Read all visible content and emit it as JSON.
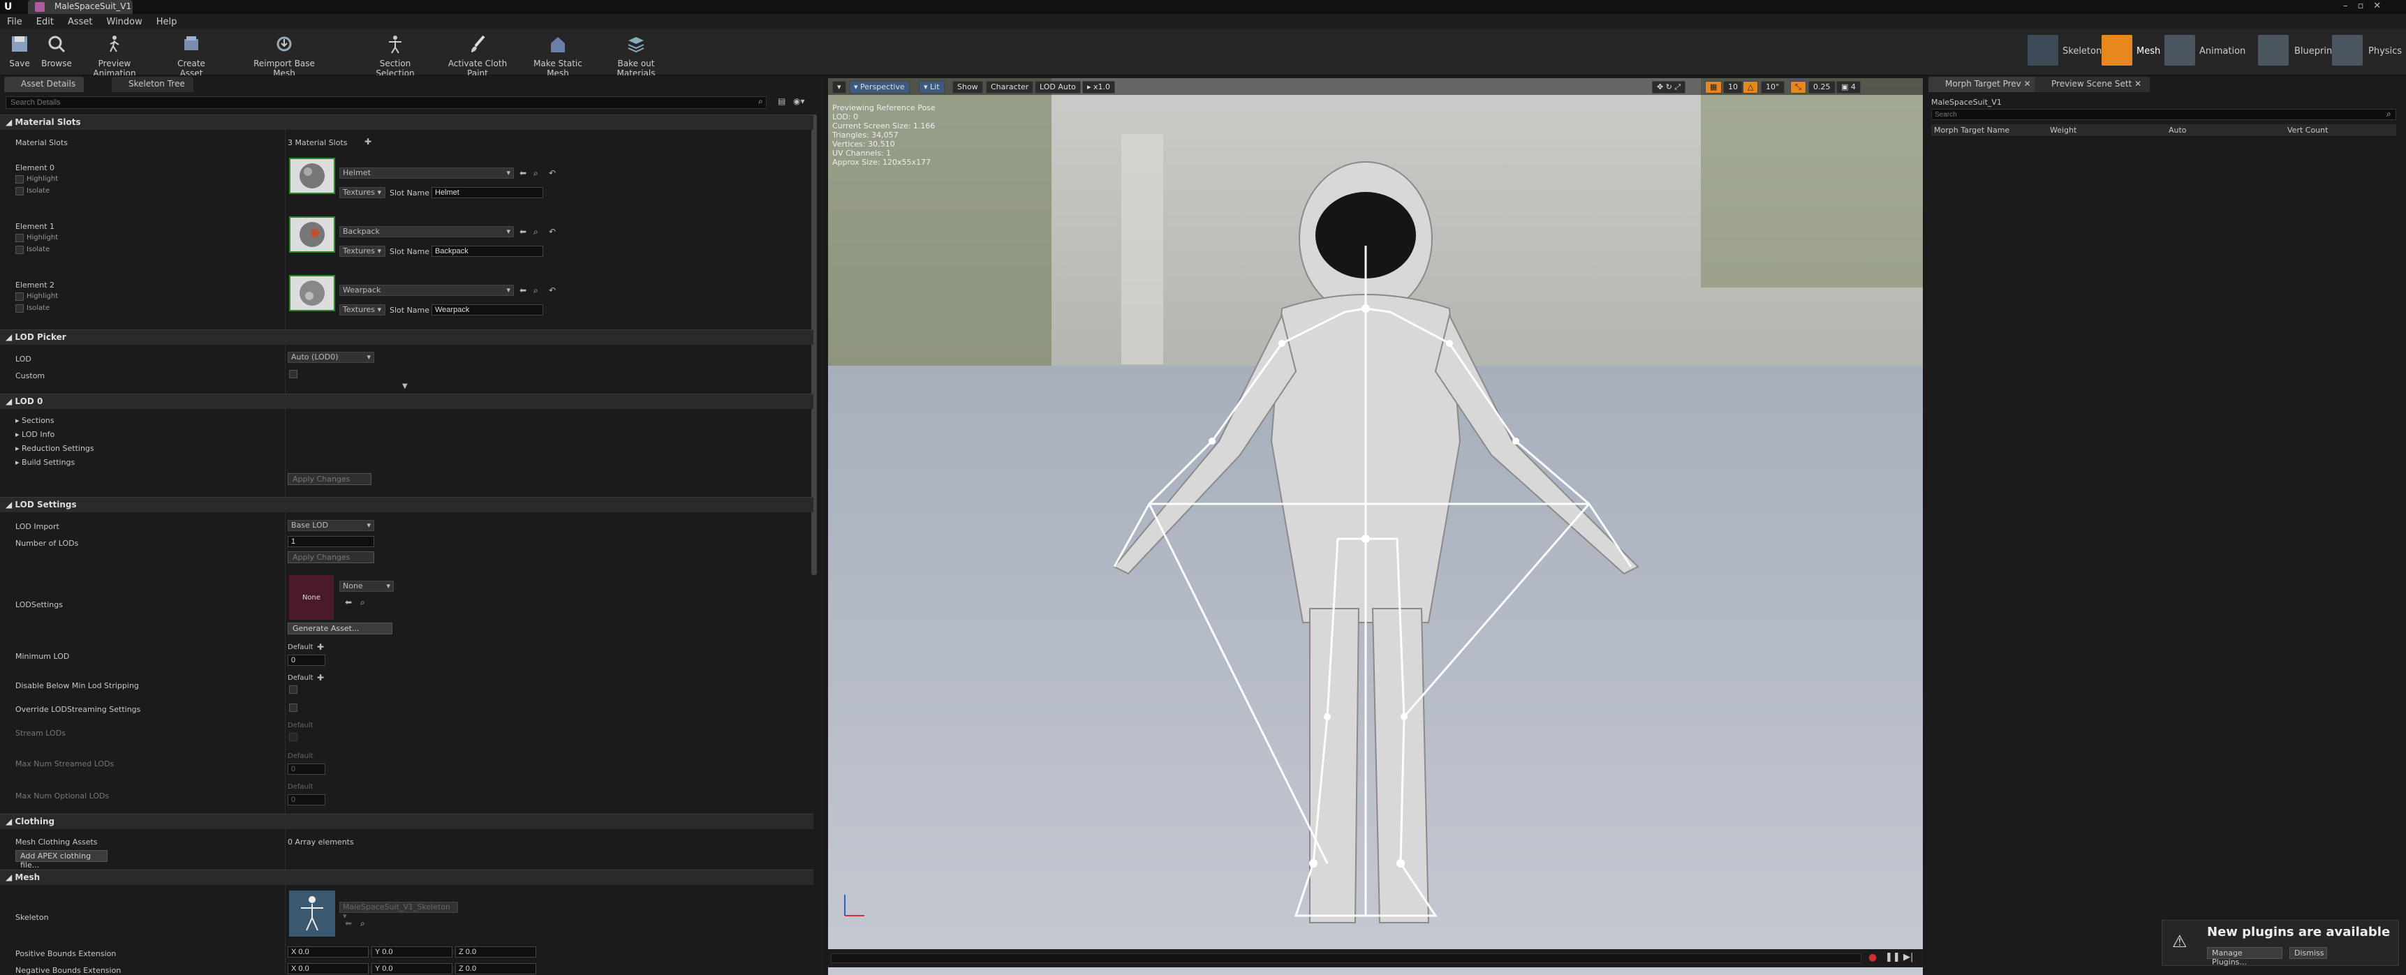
{
  "window": {
    "tab_title": "MaleSpaceSuit_V1"
  },
  "menu": [
    "File",
    "Edit",
    "Asset",
    "Window",
    "Help"
  ],
  "toolbar": {
    "save": "Save",
    "browse": "Browse",
    "preview_animation": "Preview Animation",
    "create_asset": "Create Asset",
    "reimport": "Reimport Base Mesh",
    "section_selection": "Section Selection",
    "cloth_paint": "Activate Cloth Paint",
    "make_static": "Make Static Mesh",
    "bake_materials": "Bake out Materials"
  },
  "modes": {
    "skeleton": "Skeleton",
    "mesh": "Mesh",
    "animation": "Animation",
    "blueprint": "Blueprint",
    "physics": "Physics"
  },
  "left_tabs": {
    "asset_details": "Asset Details",
    "skeleton_tree": "Skeleton Tree"
  },
  "search_placeholder": "Search Details",
  "material_slots": {
    "header": "Material Slots",
    "label": "Material Slots",
    "count": "3 Material Slots",
    "highlight": "Highlight",
    "isolate": "Isolate",
    "textures": "Textures",
    "slot_name_label": "Slot Name",
    "elements": [
      {
        "label": "Element 0",
        "material": "Helmet",
        "slot_name": "Helmet"
      },
      {
        "label": "Element 1",
        "material": "Backpack",
        "slot_name": "Backpack"
      },
      {
        "label": "Element 2",
        "material": "Wearpack",
        "slot_name": "Wearpack"
      }
    ]
  },
  "lod_picker": {
    "header": "LOD Picker",
    "lod_label": "LOD",
    "lod_value": "Auto (LOD0)",
    "custom_label": "Custom"
  },
  "lod0": {
    "header": "LOD 0",
    "items": [
      "Sections",
      "LOD Info",
      "Reduction Settings",
      "Build Settings"
    ],
    "apply": "Apply Changes"
  },
  "lod_settings": {
    "header": "LOD Settings",
    "lod_import_label": "LOD Import",
    "lod_import_value": "Base LOD",
    "num_lods_label": "Number of LODs",
    "num_lods_value": "1",
    "apply": "Apply Changes",
    "lodsettings_label": "LODSettings",
    "lodsettings_thumb": "None",
    "lodsettings_value": "None",
    "generate": "Generate Asset...",
    "default": "Default",
    "min_lod_label": "Minimum LOD",
    "min_lod_value": "0",
    "disable_strip_label": "Disable Below Min Lod Stripping",
    "override_label": "Override LODStreaming Settings",
    "stream_lods_label": "Stream LODs",
    "max_streamed_label": "Max Num Streamed LODs",
    "max_streamed_value": "0",
    "max_optional_label": "Max Num Optional LODs",
    "max_optional_value": "0"
  },
  "clothing": {
    "header": "Clothing",
    "assets_label": "Mesh Clothing Assets",
    "assets_value": "0 Array elements",
    "add_btn": "Add APEX clothing file..."
  },
  "mesh": {
    "header": "Mesh",
    "skeleton_label": "Skeleton",
    "skeleton_value": "MaleSpaceSuit_V1_Skeleton",
    "pos_bounds_label": "Positive Bounds Extension",
    "neg_bounds_label": "Negative Bounds Extension",
    "x": "X 0.0",
    "y": "Y 0.0",
    "z": "Z 0.0"
  },
  "viewport": {
    "perspective": "Perspective",
    "lit": "Lit",
    "show": "Show",
    "character": "Character",
    "lod": "LOD Auto",
    "speed": "x1.0",
    "grid": "10",
    "angle": "10°",
    "scale": "0.25",
    "cam": "4",
    "stats": [
      "Previewing Reference Pose",
      "LOD: 0",
      "Current Screen Size: 1.166",
      "Triangles: 34,057",
      "Vertices: 30,510",
      "UV Channels: 1",
      "Approx Size: 120x55x177"
    ]
  },
  "right": {
    "tab1": "Morph Target Prev",
    "tab2": "Preview Scene Sett",
    "mesh_name": "MaleSpaceSuit_V1",
    "search": "Search",
    "columns": [
      "Morph Target Name",
      "Weight",
      "Auto",
      "Vert Count"
    ]
  },
  "notification": {
    "title": "New plugins are available",
    "manage": "Manage Plugins...",
    "dismiss": "Dismiss"
  },
  "colors": {
    "accent": "#e8871e",
    "bg": "#1b1b1b"
  }
}
